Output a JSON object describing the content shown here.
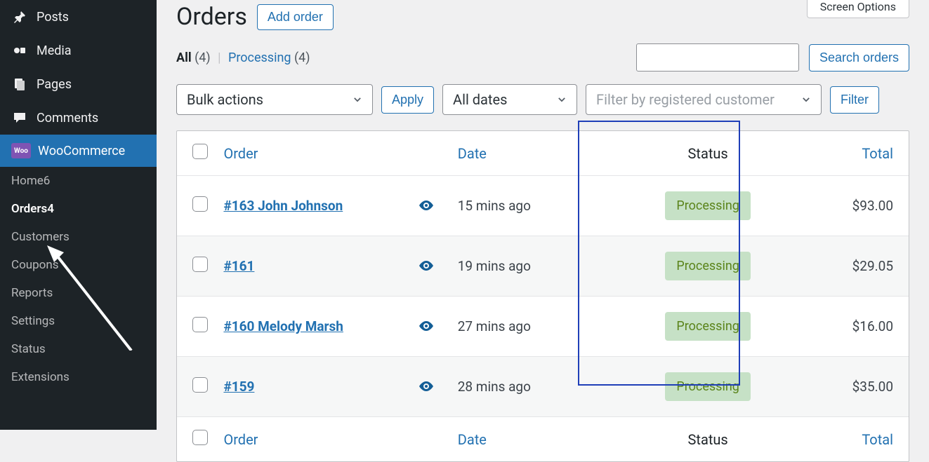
{
  "screen_options": "Screen Options",
  "page": {
    "title": "Orders",
    "add_order": "Add order"
  },
  "filter_links": {
    "all_label": "All",
    "all_count": "(4)",
    "processing_label": "Processing",
    "processing_count": "(4)"
  },
  "search": {
    "button": "Search orders"
  },
  "bulk_actions": {
    "label": "Bulk actions",
    "apply": "Apply"
  },
  "date_filter": {
    "label": "All dates"
  },
  "customer_filter": {
    "placeholder": "Filter by registered customer"
  },
  "filter_button": "Filter",
  "columns": {
    "order": "Order",
    "date": "Date",
    "status": "Status",
    "total": "Total"
  },
  "orders": [
    {
      "order": "#163 John Johnson",
      "date": "15 mins ago",
      "status": "Processing",
      "total": "$93.00"
    },
    {
      "order": "#161",
      "date": "19 mins ago",
      "status": "Processing",
      "total": "$29.05"
    },
    {
      "order": "#160 Melody Marsh",
      "date": "27 mins ago",
      "status": "Processing",
      "total": "$16.00"
    },
    {
      "order": "#159",
      "date": "28 mins ago",
      "status": "Processing",
      "total": "$35.00"
    }
  ],
  "sidebar": {
    "posts": "Posts",
    "media": "Media",
    "pages": "Pages",
    "comments": "Comments",
    "woocommerce": "WooCommerce",
    "home": "Home",
    "home_badge": "6",
    "orders": "Orders",
    "orders_badge": "4",
    "customers": "Customers",
    "coupons": "Coupons",
    "reports": "Reports",
    "settings": "Settings",
    "status": "Status",
    "extensions": "Extensions"
  },
  "icons": {
    "woo": "Woo"
  }
}
